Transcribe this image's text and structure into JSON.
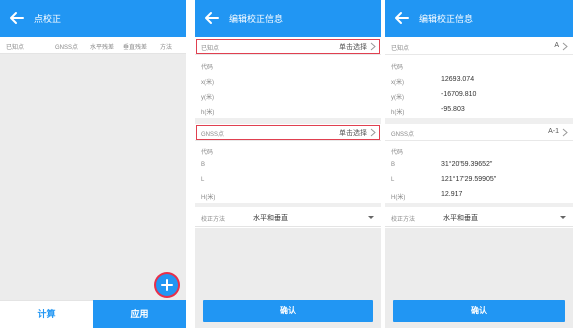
{
  "screen1": {
    "title": "点校正",
    "columns": [
      "已知点",
      "GNSS点",
      "水平残差",
      "垂直残差",
      "方法"
    ],
    "calc_label": "计算",
    "apply_label": "应用",
    "fab_icon": "plus-icon"
  },
  "screen2": {
    "title": "编辑校正信息",
    "known_point_label": "已知点",
    "known_point_action": "单击选择",
    "known_fields": [
      {
        "label": "代码",
        "value": ""
      },
      {
        "label": "x(米)",
        "value": ""
      },
      {
        "label": "y(米)",
        "value": ""
      },
      {
        "label": "h(米)",
        "value": ""
      }
    ],
    "gnss_point_label": "GNSS点",
    "gnss_point_action": "单击选择",
    "gnss_fields": [
      {
        "label": "代码",
        "value": ""
      },
      {
        "label": "B",
        "value": ""
      },
      {
        "label": "L",
        "value": ""
      },
      {
        "label": "H(米)",
        "value": ""
      }
    ],
    "method_label": "校正方法",
    "method_value": "水平和垂直",
    "confirm_label": "确认"
  },
  "screen3": {
    "title": "编辑校正信息",
    "known_point_label": "已知点",
    "known_point_value": "A",
    "known_fields": [
      {
        "label": "代码",
        "value": ""
      },
      {
        "label": "x(米)",
        "value": "12693.074"
      },
      {
        "label": "y(米)",
        "value": "-16709.810"
      },
      {
        "label": "h(米)",
        "value": "-95.803"
      }
    ],
    "gnss_point_label": "GNSS点",
    "gnss_point_value": "A-1",
    "gnss_fields": [
      {
        "label": "代码",
        "value": ""
      },
      {
        "label": "B",
        "value": "31°20'59.39652\""
      },
      {
        "label": "L",
        "value": "121°17'29.59905\""
      },
      {
        "label": "H(米)",
        "value": "12.917"
      }
    ],
    "method_label": "校正方法",
    "method_value": "水平和垂直",
    "confirm_label": "确认"
  },
  "colors": {
    "primary": "#2196f3",
    "highlight": "#e04050",
    "background_gray": "#ececec"
  }
}
